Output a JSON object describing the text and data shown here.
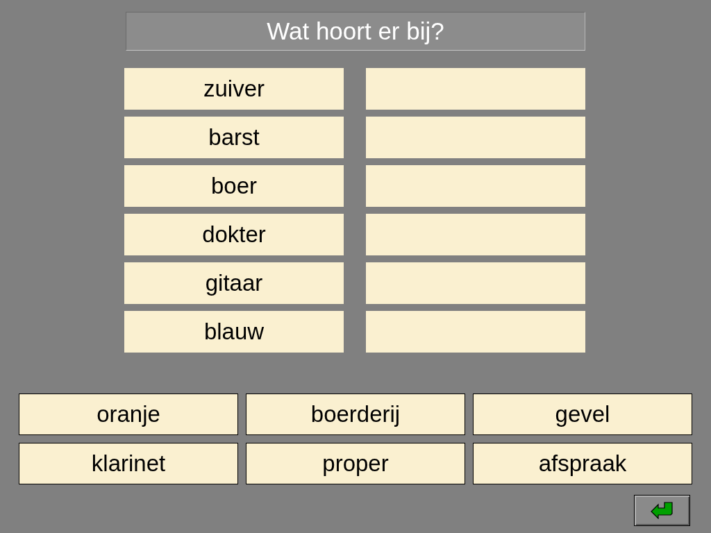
{
  "title": "Wat hoort er bij?",
  "pairs": [
    {
      "word": "zuiver"
    },
    {
      "word": "barst"
    },
    {
      "word": "boer"
    },
    {
      "word": "dokter"
    },
    {
      "word": "gitaar"
    },
    {
      "word": "blauw"
    }
  ],
  "choices": [
    "oranje",
    "boerderij",
    "gevel",
    "klarinet",
    "proper",
    "afspraak"
  ]
}
